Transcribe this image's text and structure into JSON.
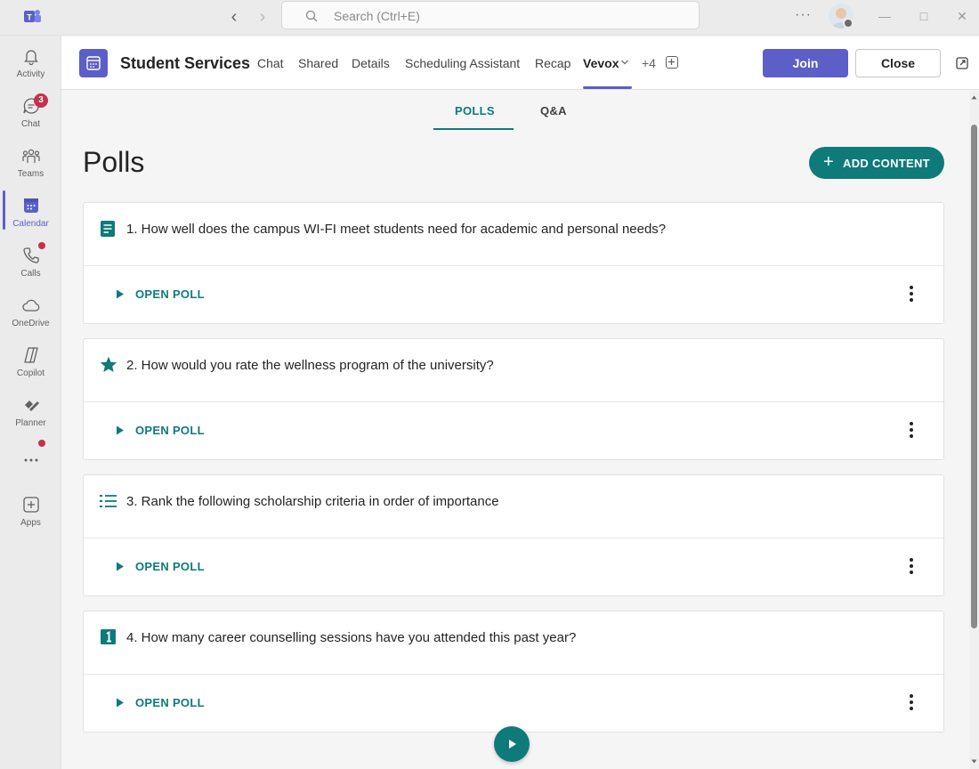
{
  "titlebar": {
    "search_placeholder": "Search (Ctrl+E)",
    "more_label": "···"
  },
  "rail": {
    "items": [
      {
        "label": "Activity",
        "icon": "bell-icon"
      },
      {
        "label": "Chat",
        "icon": "chat-icon",
        "badge": "3"
      },
      {
        "label": "Teams",
        "icon": "teams-icon"
      },
      {
        "label": "Calendar",
        "icon": "calendar-icon"
      },
      {
        "label": "Calls",
        "icon": "phone-icon"
      },
      {
        "label": "OneDrive",
        "icon": "cloud-icon"
      },
      {
        "label": "Copilot",
        "icon": "copilot-icon"
      },
      {
        "label": "Planner",
        "icon": "planner-icon"
      },
      {
        "label": "",
        "icon": "more-icon"
      },
      {
        "label": "Apps",
        "icon": "apps-icon"
      }
    ],
    "active": "Calendar"
  },
  "header": {
    "title": "Student Services",
    "tabs": [
      "Chat",
      "Shared",
      "Details",
      "Scheduling Assistant",
      "Recap",
      "Vevox"
    ],
    "active_tab": "Vevox",
    "more_count": "+4",
    "join_label": "Join",
    "close_label": "Close"
  },
  "subtabs": {
    "items": [
      "POLLS",
      "Q&A"
    ],
    "active": "POLLS"
  },
  "page": {
    "title": "Polls",
    "add_content_label": "ADD CONTENT"
  },
  "polls": [
    {
      "question": "1. How well does the campus WI-FI meet students need for academic and personal needs?",
      "icon": "text-response-icon",
      "action": "OPEN POLL"
    },
    {
      "question": "2. How would you rate the wellness program of the university?",
      "icon": "star-rating-icon",
      "action": "OPEN POLL"
    },
    {
      "question": "3. Rank the following scholarship criteria in order of importance",
      "icon": "ranking-list-icon",
      "action": "OPEN POLL"
    },
    {
      "question": "4. How many career counselling sessions have you attended this past year?",
      "icon": "numeric-icon",
      "action": "OPEN POLL"
    }
  ],
  "colors": {
    "teams_purple": "#5b5fc7",
    "vevox_teal": "#0e7a7a",
    "badge_red": "#c4314b"
  }
}
